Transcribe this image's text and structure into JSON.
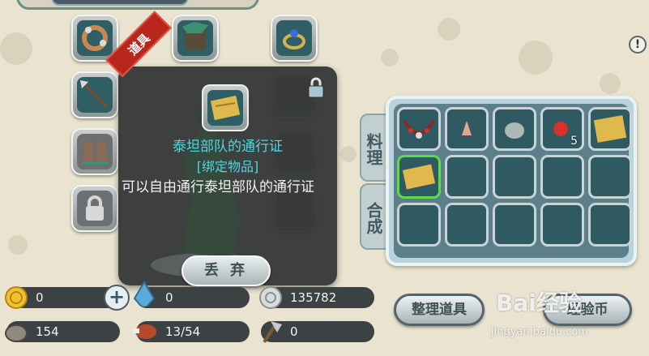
{
  "equipment": {
    "slots": [
      {
        "icon": "bracelet-icon"
      },
      {
        "icon": "armor-icon"
      },
      {
        "icon": "ring-icon"
      },
      {
        "icon": "spear-icon"
      },
      {
        "icon": "hidden-slot"
      },
      {
        "icon": "lock-icon"
      },
      {
        "icon": "boots-icon"
      },
      {
        "icon": "hidden-slot"
      },
      {
        "icon": "lock-icon"
      },
      {
        "icon": "lock-icon"
      }
    ]
  },
  "tooltip": {
    "tag": "道具",
    "item_name": "泰坦部队的通行证",
    "bound_label": "[绑定物品]",
    "description": "可以自由通行泰坦部队的通行证",
    "discard_label": "丢 弃",
    "item_icon": "map-scroll-icon"
  },
  "tabs": {
    "materials": "料理",
    "craft": "合成"
  },
  "inventory": {
    "slots": [
      {
        "icon": "necklace-icon",
        "count": ""
      },
      {
        "icon": "shell-icon",
        "count": ""
      },
      {
        "icon": "stone-icon",
        "count": ""
      },
      {
        "icon": "red-gem-icon",
        "count": "5"
      },
      {
        "icon": "scroll-icon",
        "count": ""
      },
      {
        "icon": "map-scroll-icon",
        "count": "",
        "selected": true
      },
      {
        "icon": "empty",
        "count": ""
      },
      {
        "icon": "empty",
        "count": ""
      },
      {
        "icon": "empty",
        "count": ""
      },
      {
        "icon": "empty",
        "count": ""
      },
      {
        "icon": "empty",
        "count": ""
      },
      {
        "icon": "empty",
        "count": ""
      },
      {
        "icon": "empty",
        "count": ""
      },
      {
        "icon": "empty",
        "count": ""
      },
      {
        "icon": "empty",
        "count": ""
      }
    ]
  },
  "resources": {
    "gold": "0",
    "crystal": "0",
    "silver": "135782",
    "stone": "154",
    "food": "13/54",
    "tool": "0"
  },
  "buttons": {
    "sort": "整理道具",
    "exp": "经验币",
    "info": "!"
  },
  "watermark": {
    "brand": "Bai经验",
    "url": "jingyan.baidu.com"
  }
}
